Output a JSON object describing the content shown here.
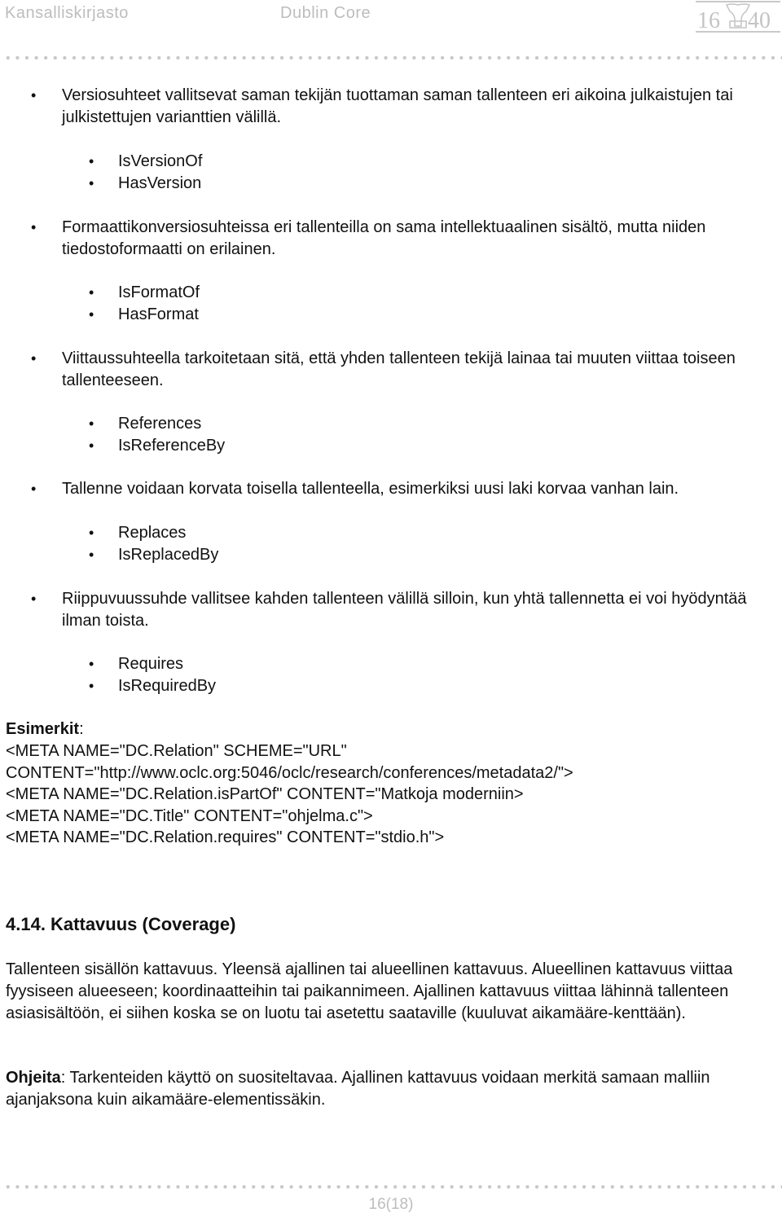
{
  "header": {
    "left": "Kansalliskirjasto",
    "center": "Dublin Core",
    "logo": "16 40 (column capital logo)"
  },
  "relations": [
    {
      "description": "Versiosuhteet vallitsevat saman tekijän tuottaman saman tallenteen eri aikoina julkaistujen tai julkistettujen varianttien välillä.",
      "terms": [
        "IsVersionOf",
        "HasVersion"
      ]
    },
    {
      "description": "Formaattikonversiosuhteissa eri tallenteilla on sama intellektuaalinen sisältö, mutta niiden tiedostoformaatti on erilainen.",
      "terms": [
        "IsFormatOf",
        "HasFormat"
      ]
    },
    {
      "description": "Viittaussuhteella tarkoitetaan sitä, että yhden tallenteen tekijä lainaa tai muuten viittaa toiseen tallenteeseen.",
      "terms": [
        "References",
        "IsReferenceBy"
      ]
    },
    {
      "description": "Tallenne voidaan korvata toisella tallenteella, esimerkiksi uusi laki korvaa vanhan lain.",
      "terms": [
        "Replaces",
        "IsReplacedBy"
      ]
    },
    {
      "description": "Riippuvuussuhde vallitsee kahden tallenteen välillä silloin, kun yhtä tallennetta ei voi hyödyntää ilman toista.",
      "terms": [
        "Requires",
        "IsRequiredBy"
      ]
    }
  ],
  "examples": {
    "label": "Esimerkit",
    "colon": ":",
    "lines": [
      "<META NAME=\"DC.Relation\" SCHEME=\"URL\"",
      "CONTENT=\"http://www.oclc.org:5046/oclc/research/conferences/metadata2/\">",
      "<META NAME=\"DC.Relation.isPartOf\" CONTENT=\"Matkoja moderniin>",
      "<META NAME=\"DC.Title\" CONTENT=\"ohjelma.c\">",
      "<META NAME=\"DC.Relation.requires\" CONTENT=\"stdio.h\">"
    ]
  },
  "section": {
    "heading": "4.14. Kattavuus (Coverage)",
    "body": "Tallenteen sisällön kattavuus. Yleensä ajallinen tai alueellinen kattavuus. Alueellinen kattavuus viittaa fyysiseen alueeseen; koordinaatteihin tai paikannimeen. Ajallinen kattavuus viittaa lähinnä tallenteen asiasisältöön, ei siihen koska se on luotu tai asetettu saataville (kuuluvat aikamääre-kenttään).",
    "guidance_label": "Ohjeita",
    "guidance_text": ": Tarkenteiden käyttö on suositeltavaa. Ajallinen kattavuus voidaan merkitä samaan malliin ajanjaksona kuin aikamääre-elementissäkin."
  },
  "footer": {
    "page": "16(18)"
  }
}
